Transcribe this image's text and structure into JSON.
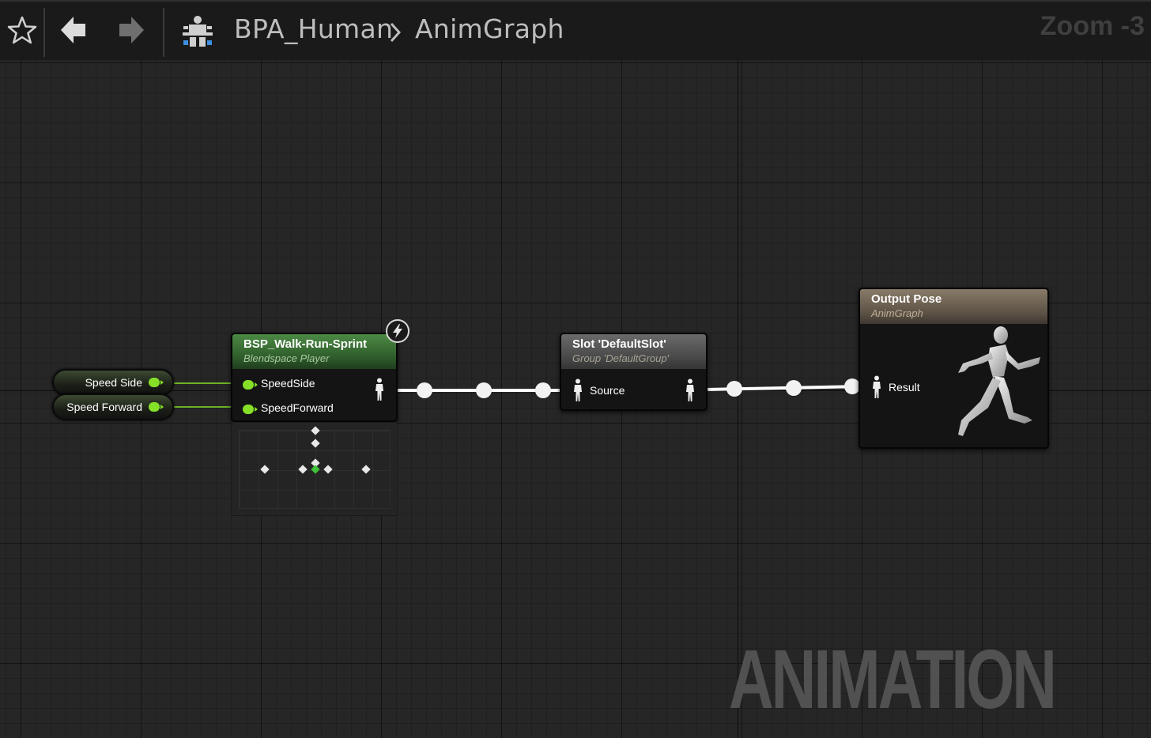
{
  "toolbar": {
    "favorite_icon": "star-icon",
    "back_icon": "back-arrow-icon",
    "forward_icon": "forward-arrow-icon",
    "blueprint_icon": "anim-blueprint-icon",
    "breadcrumb": [
      "BPA_Human",
      "AnimGraph"
    ],
    "breadcrumb_separator_icon": "chevron-right-icon",
    "zoom": "Zoom -3"
  },
  "variables": [
    {
      "label": "Speed Side",
      "pin_color": "#85e027"
    },
    {
      "label": "Speed Forward",
      "pin_color": "#85e027"
    }
  ],
  "nodes": {
    "blendspace": {
      "title": "BSP_Walk-Run-Sprint",
      "subtitle": "Blendspace Player",
      "header_color": "#3f7a3a",
      "inputs": [
        "SpeedSide",
        "SpeedForward"
      ],
      "badge_icon": "lightning-icon"
    },
    "slot": {
      "title": "Slot 'DefaultSlot'",
      "subtitle": "Group 'DefaultGroup'",
      "header_color": "#5a5a5a",
      "input": "Source"
    },
    "output": {
      "title": "Output Pose",
      "subtitle": "AnimGraph",
      "header_color": "#6e6253",
      "input": "Result",
      "preview_icon": "running-mannequin-icon"
    }
  },
  "colors": {
    "float_pin": "#85e027",
    "pose_wire": "#ffffff",
    "grid_bg": "#262626"
  },
  "watermark": "ANIMATION"
}
